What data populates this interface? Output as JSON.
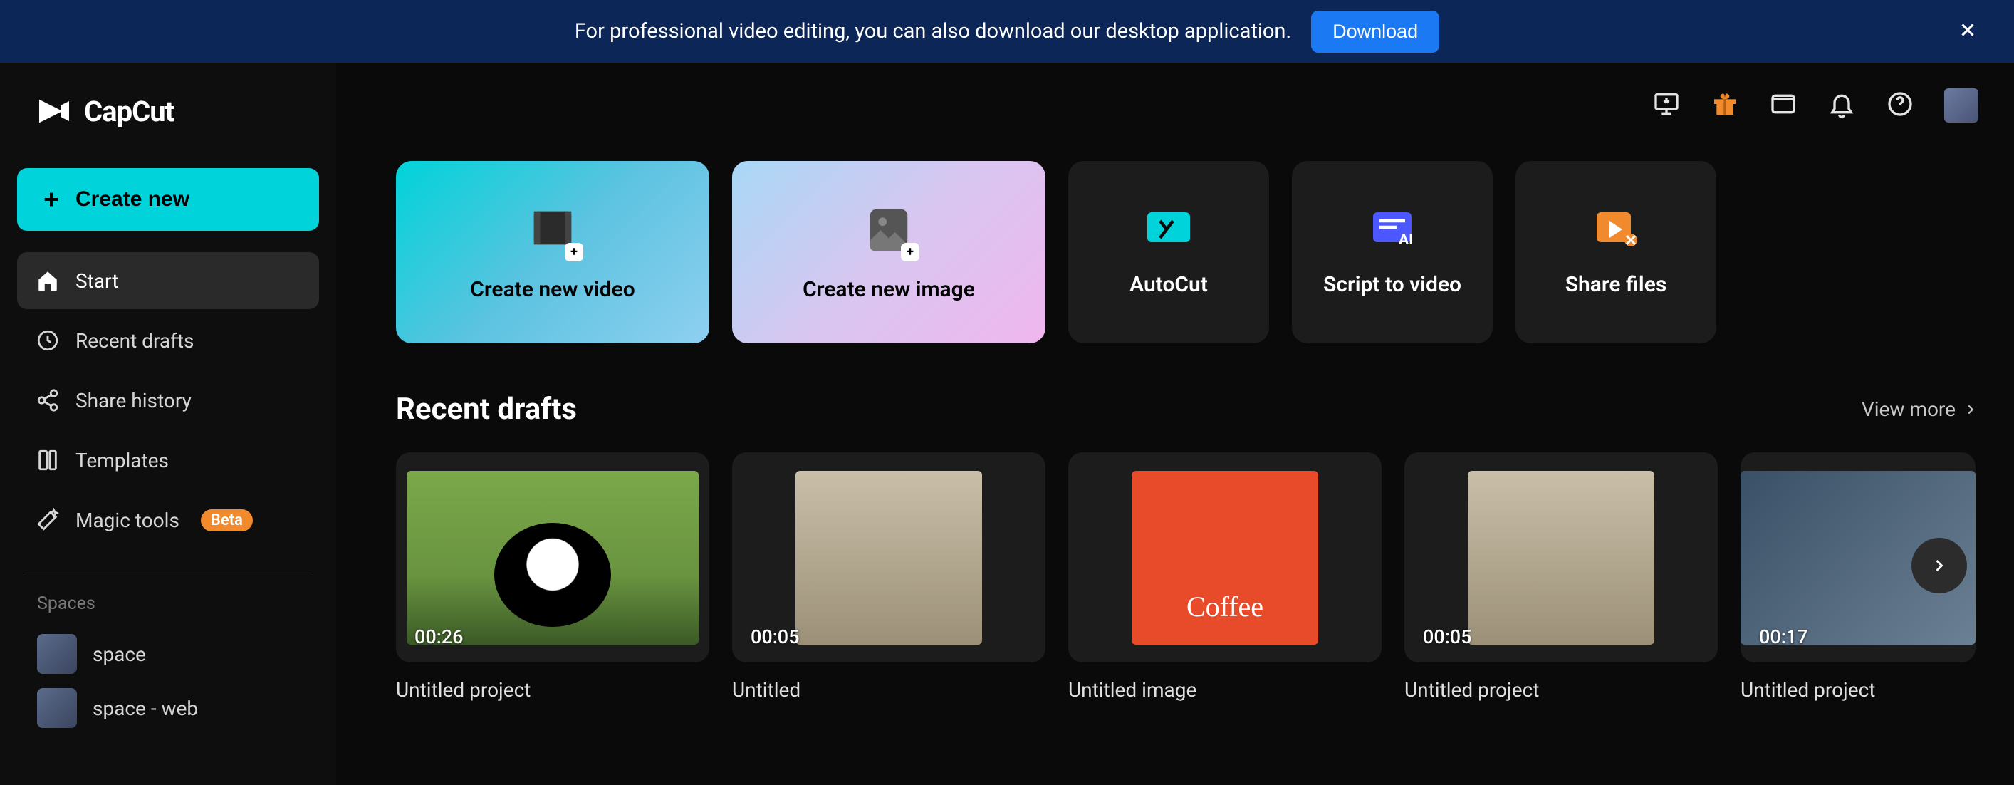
{
  "banner": {
    "text": "For professional video editing, you can also download our desktop application.",
    "download_label": "Download"
  },
  "brand": {
    "name": "CapCut"
  },
  "sidebar": {
    "create_label": "Create new",
    "nav": [
      {
        "label": "Start"
      },
      {
        "label": "Recent drafts"
      },
      {
        "label": "Share history"
      },
      {
        "label": "Templates"
      },
      {
        "label": "Magic tools",
        "badge": "Beta"
      }
    ],
    "spaces_label": "Spaces",
    "spaces": [
      {
        "label": "space"
      },
      {
        "label": "space - web"
      }
    ]
  },
  "tiles": [
    {
      "label": "Create new video"
    },
    {
      "label": "Create new image"
    },
    {
      "label": "AutoCut"
    },
    {
      "label": "Script to video"
    },
    {
      "label": "Share files"
    }
  ],
  "recent": {
    "title": "Recent drafts",
    "view_more": "View more",
    "items": [
      {
        "title": "Untitled project",
        "duration": "00:26"
      },
      {
        "title": "Untitled",
        "duration": "00:05"
      },
      {
        "title": "Untitled image",
        "duration": ""
      },
      {
        "title": "Untitled project",
        "duration": "00:05"
      },
      {
        "title": "Untitled project",
        "duration": "00:17"
      }
    ]
  },
  "colors": {
    "accent": "#00d3d9",
    "banner_bg": "#0c2657",
    "download_btn": "#1b79f4"
  }
}
